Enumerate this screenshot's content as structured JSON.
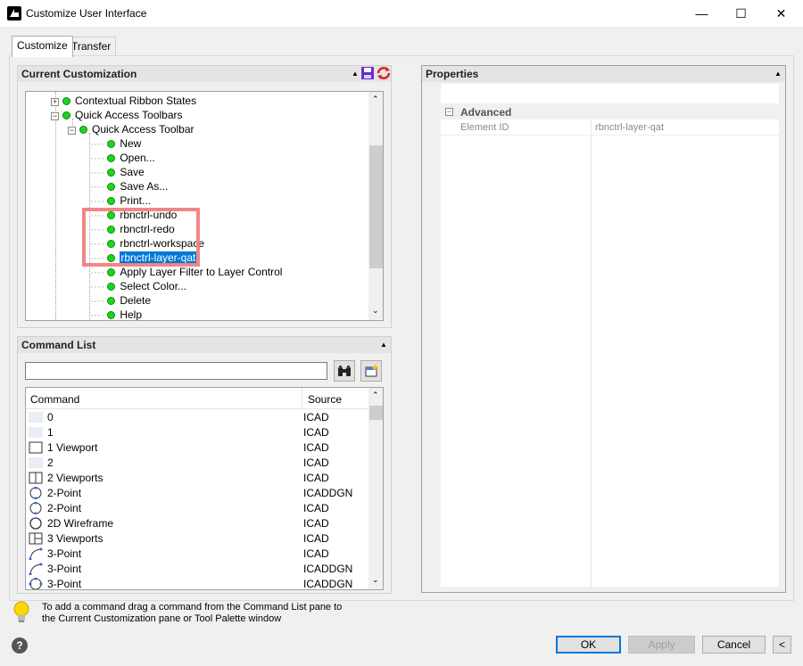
{
  "window": {
    "title": "Customize User Interface",
    "minimize_glyph": "—",
    "maximize_glyph": "☐",
    "close_glyph": "✕"
  },
  "tabs": [
    {
      "label": "Customize",
      "active": true
    },
    {
      "label": "Transfer",
      "active": false
    }
  ],
  "current_customization": {
    "header": "Current Customization",
    "tree": [
      {
        "label": "Contextual Ribbon States",
        "level": 1,
        "expander": "+"
      },
      {
        "label": "Quick Access Toolbars",
        "level": 1,
        "expander": "−"
      },
      {
        "label": "Quick Access Toolbar",
        "level": 2,
        "expander": "−"
      },
      {
        "label": "New",
        "level": 3
      },
      {
        "label": "Open...",
        "level": 3
      },
      {
        "label": "Save",
        "level": 3
      },
      {
        "label": "Save As...",
        "level": 3
      },
      {
        "label": "Print...",
        "level": 3
      },
      {
        "label": "rbnctrl-undo",
        "level": 3
      },
      {
        "label": "rbnctrl-redo",
        "level": 3
      },
      {
        "label": "rbnctrl-workspace",
        "level": 3
      },
      {
        "label": "rbnctrl-layer-qat",
        "level": 3,
        "selected": true
      },
      {
        "label": "Apply Layer Filter to Layer Control",
        "level": 3
      },
      {
        "label": "Select Color...",
        "level": 3
      },
      {
        "label": "Delete",
        "level": 3
      },
      {
        "label": "Help",
        "level": 3
      }
    ]
  },
  "command_list": {
    "header": "Command List",
    "search_value": "",
    "columns": [
      "Command",
      "Source"
    ],
    "rows": [
      {
        "command": "0",
        "source": "ICAD",
        "icon": "blank"
      },
      {
        "command": "1",
        "source": "ICAD",
        "icon": "blank"
      },
      {
        "command": "1 Viewport",
        "source": "ICAD",
        "icon": "single-viewport-icon"
      },
      {
        "command": "2",
        "source": "ICAD",
        "icon": "blank"
      },
      {
        "command": "2 Viewports",
        "source": "ICAD",
        "icon": "two-viewports-icon"
      },
      {
        "command": "2-Point",
        "source": "ICADDGN",
        "icon": "circle-2pt-icon"
      },
      {
        "command": "2-Point",
        "source": "ICAD",
        "icon": "circle-2pt-icon"
      },
      {
        "command": "2D Wireframe",
        "source": "ICAD",
        "icon": "circle-icon"
      },
      {
        "command": "3 Viewports",
        "source": "ICAD",
        "icon": "three-viewports-icon"
      },
      {
        "command": "3-Point",
        "source": "ICAD",
        "icon": "arc-3pt-icon"
      },
      {
        "command": "3-Point",
        "source": "ICADDGN",
        "icon": "arc-3pt-icon"
      },
      {
        "command": "3-Point",
        "source": "ICADDGN",
        "icon": "circle-3pt-icon"
      }
    ]
  },
  "properties": {
    "header": "Properties",
    "section": "Advanced",
    "rows": [
      {
        "name": "Element ID",
        "value": "rbnctrl-layer-qat"
      }
    ]
  },
  "hint": {
    "line1": "To add a command drag a command from the Command List pane to",
    "line2": "the Current Customization pane or Tool Palette window"
  },
  "buttons": {
    "ok": "OK",
    "apply": "Apply",
    "cancel": "Cancel",
    "collapse": "<",
    "help": "?"
  },
  "colors": {
    "accent": "#0078d7",
    "highlight_box": "#f08080",
    "node_dot": "#1ed41e"
  }
}
